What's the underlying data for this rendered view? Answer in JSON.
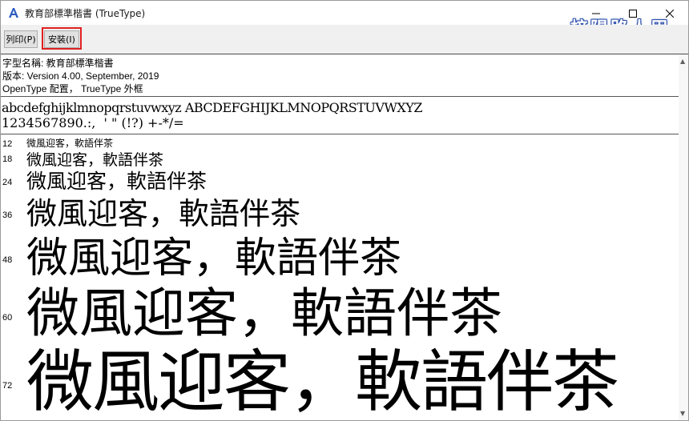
{
  "window": {
    "title": "教育部標準楷書 (TrueType)",
    "watermark": "梓陽路人甲"
  },
  "toolbar": {
    "print_label": "列印(P)",
    "install_label": "安裝(I)"
  },
  "font_info": {
    "name_line": "字型名稱: 教育部標準楷書",
    "version_line": "版本: Version 4.00, September, 2019",
    "type_line": "OpenType 配置， TrueType 外框"
  },
  "charset": {
    "letters": "abcdefghijklmnopqrstuvwxyz ABCDEFGHIJKLMNOPQRSTUVWXYZ",
    "digits": "1234567890.:,  ' \" (!?) +-*/="
  },
  "samples": [
    {
      "size": "12",
      "text": "微風迎客，軟語伴茶"
    },
    {
      "size": "18",
      "text": "微風迎客，軟語伴茶"
    },
    {
      "size": "24",
      "text": "微風迎客，軟語伴茶"
    },
    {
      "size": "36",
      "text": "微風迎客，軟語伴茶"
    },
    {
      "size": "48",
      "text": "微風迎客，軟語伴茶"
    },
    {
      "size": "60",
      "text": "微風迎客，軟語伴茶"
    },
    {
      "size": "72",
      "text": "微風迎客，軟語伴茶"
    }
  ],
  "colors": {
    "highlight": "#e02020",
    "watermark_outline": "#2a4da8"
  }
}
